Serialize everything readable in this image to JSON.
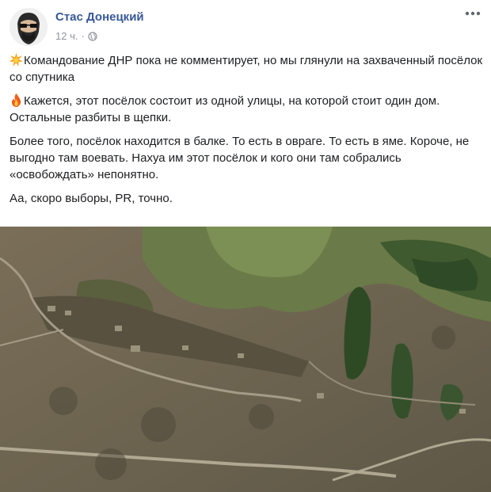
{
  "post": {
    "author": "Стас Донецкий",
    "time": "12 ч.",
    "separator": "·",
    "privacy_icon": "globe-icon",
    "menu_icon": "more-icon",
    "paragraphs": [
      {
        "emoji": "collision-icon",
        "text": "Командование ДНР пока не комментирует, но мы глянули на захваченный посёлок со спутника"
      },
      {
        "emoji": "fire-icon",
        "text": "Кажется, этот посёлок состоит из одной улицы, на которой стоит один дом. Остальные разбиты в щепки."
      },
      {
        "emoji": "",
        "text": "Более того, посёлок находится в балке. То есть в овраге. То есть в яме. Короче, не выгодно там воевать. Нахуа им этот посёлок и кого они там собрались «освобождать» непонятно."
      },
      {
        "emoji": "",
        "text": "Аа, скоро выборы, PR, точно."
      }
    ],
    "image": "satellite-photo"
  }
}
